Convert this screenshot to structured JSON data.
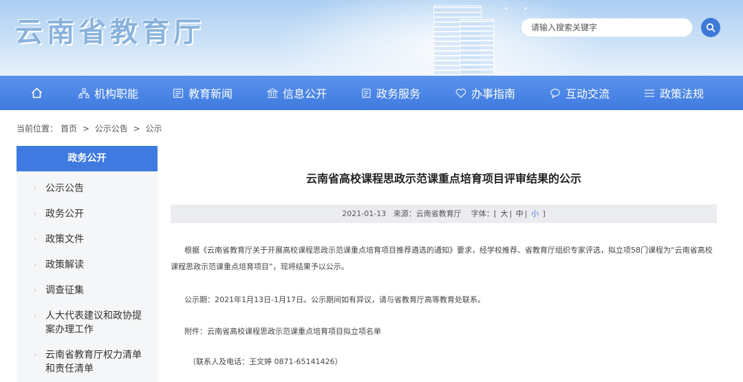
{
  "header": {
    "site_title": "云南省教育厅",
    "search_placeholder": "请输入搜索关键字"
  },
  "nav": {
    "items": [
      {
        "label": "机构职能",
        "icon": "org-chart-icon"
      },
      {
        "label": "教育新闻",
        "icon": "news-icon"
      },
      {
        "label": "信息公开",
        "icon": "building-icon"
      },
      {
        "label": "政务服务",
        "icon": "document-icon"
      },
      {
        "label": "办事指南",
        "icon": "heart-icon"
      },
      {
        "label": "互动交流",
        "icon": "chat-icon"
      },
      {
        "label": "政策法规",
        "icon": "list-icon"
      }
    ]
  },
  "breadcrumb": {
    "prefix": "当前位置：",
    "items": [
      "首页",
      "公示公告",
      "公示"
    ],
    "separator": ">"
  },
  "sidebar": {
    "title": "政务公开",
    "items": [
      "公示公告",
      "政务公开",
      "政策文件",
      "政策解读",
      "调查征集",
      "人大代表建议和政协提案办理工作",
      "云南省教育厅权力清单和责任清单"
    ]
  },
  "article": {
    "title": "云南省高校课程思政示范课重点培育项目评审结果的公示",
    "date": "2021-01-13",
    "source_label": "来源：",
    "source": "云南省教育厅",
    "font_label": "字体：",
    "font_open": "[",
    "font_close": "]",
    "font_sep": "|",
    "font_sizes": [
      "大",
      "中",
      "小"
    ],
    "paragraphs": [
      "根据《云南省教育厅关于开展高校课程思政示范课重点培育项目推荐遴选的通知》要求，经学校推荐、省教育厅组织专家评选，拟立项58门课程为“云南省高校课程思政示范课重点培育项目”，现将结果予以公示。",
      "公示期：2021年1月13日-1月17日。公示期间如有异议，请与省教育厅高等教育处联系。",
      "附件：云南省高校课程思政示范课重点培育项目拟立项名单",
      "（联系人及电话：王文婷 0871-65141426）"
    ]
  },
  "colors": {
    "accent": "#3f7ae0",
    "nav_top": "#5a93ec",
    "meta_bg": "#ebecef",
    "sidebar_bg": "#f5f6f8"
  }
}
